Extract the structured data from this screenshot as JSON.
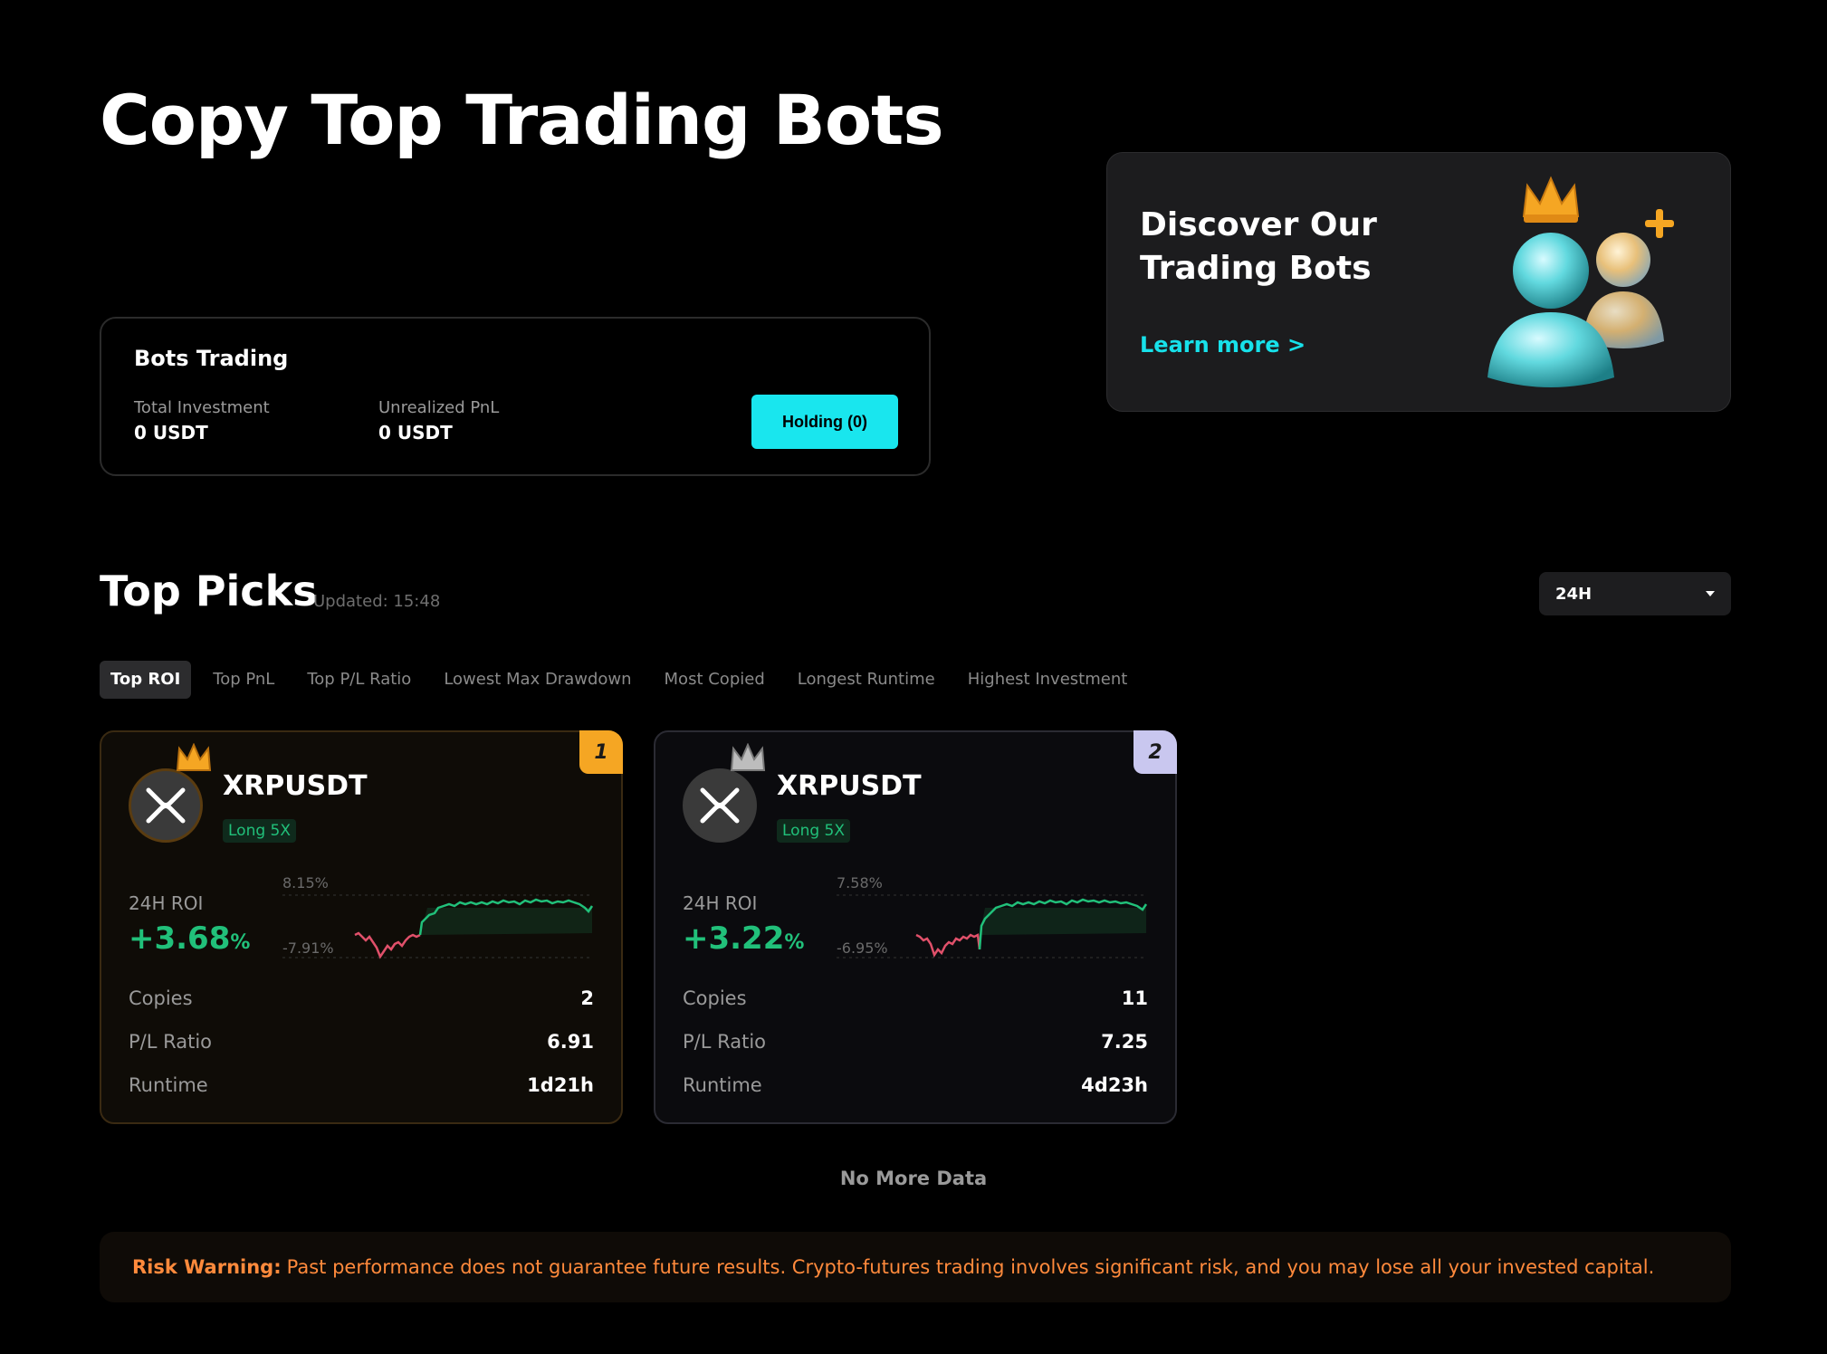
{
  "page": {
    "title": "Copy Top Trading Bots"
  },
  "bots_trading": {
    "title": "Bots Trading",
    "total_investment_label": "Total Investment",
    "total_investment_value": "0 USDT",
    "unrealized_pnl_label": "Unrealized PnL",
    "unrealized_pnl_value": "0 USDT",
    "holding_button": "Holding (0)"
  },
  "discover": {
    "title": "Discover Our Trading Bots",
    "learn_more": "Learn more >",
    "illustration_icon": "users-with-crown-icon"
  },
  "top_picks": {
    "title": "Top Picks",
    "updated": "Updated: 15:48",
    "period": "24H",
    "tabs": [
      "Top ROI",
      "Top PnL",
      "Top P/L Ratio",
      "Lowest Max Drawdown",
      "Most Copied",
      "Longest Runtime",
      "Highest Investment"
    ],
    "active_tab": "Top ROI"
  },
  "cards": [
    {
      "rank": "1",
      "pair": "XRPUSDT",
      "leverage": "Long 5X",
      "roi_label": "24H ROI",
      "roi_value": "+3.68",
      "roi_unit": "%",
      "chart_max": "8.15%",
      "chart_min": "-7.91%",
      "copies_label": "Copies",
      "copies": "2",
      "pl_ratio_label": "P/L Ratio",
      "pl_ratio": "6.91",
      "runtime_label": "Runtime",
      "runtime": "1d21h",
      "icon": "xrp-coin-icon",
      "crown": "gold-crown-icon"
    },
    {
      "rank": "2",
      "pair": "XRPUSDT",
      "leverage": "Long 5X",
      "roi_label": "24H ROI",
      "roi_value": "+3.22",
      "roi_unit": "%",
      "chart_max": "7.58%",
      "chart_min": "-6.95%",
      "copies_label": "Copies",
      "copies": "11",
      "pl_ratio_label": "P/L Ratio",
      "pl_ratio": "7.25",
      "runtime_label": "Runtime",
      "runtime": "4d23h",
      "icon": "xrp-coin-icon",
      "crown": "silver-crown-icon"
    }
  ],
  "footer": {
    "no_more": "No More Data",
    "risk_label": "Risk Warning:",
    "risk_text": "Past performance does not guarantee future results. Crypto-futures trading involves significant risk, and you may lose all your invested capital."
  },
  "colors": {
    "accent_cyan": "#19e6ee",
    "positive_green": "#21c07a",
    "negative_red": "#e0506a",
    "rank1_gold": "#f5a623",
    "rank2_lavender": "#c9c7ef",
    "warning_orange": "#ff8a3c"
  }
}
